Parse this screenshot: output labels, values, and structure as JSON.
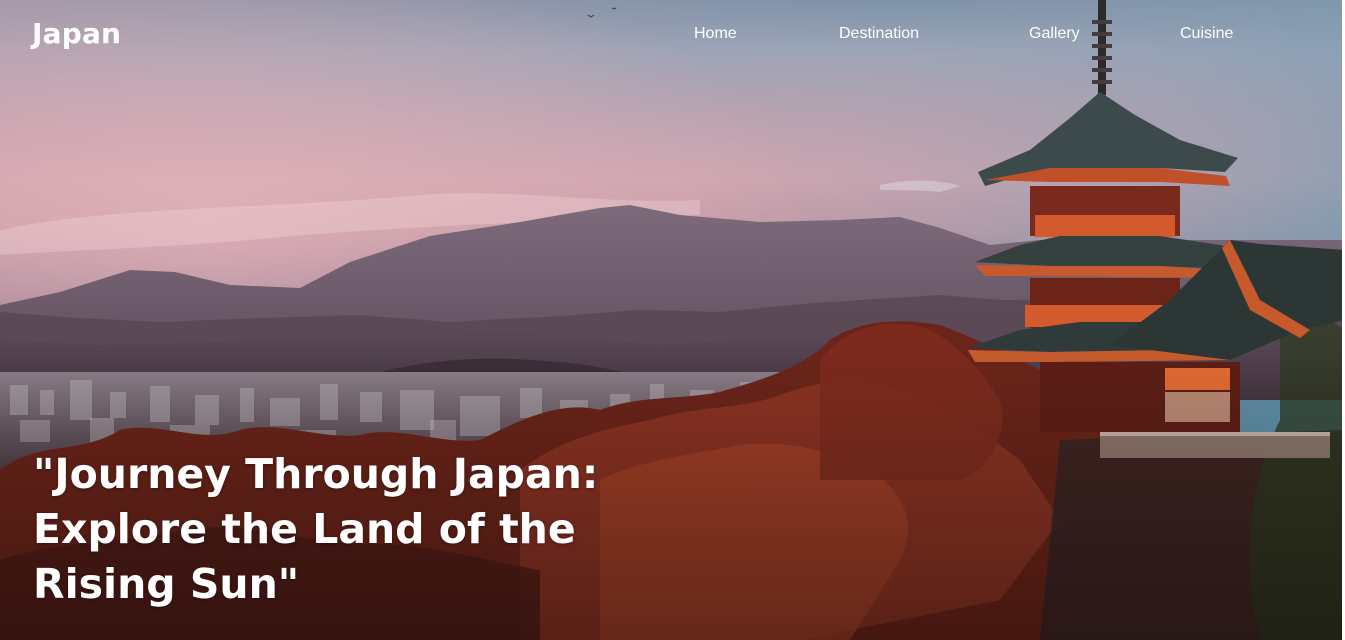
{
  "header": {
    "logo": "Japan",
    "nav": [
      {
        "label": "Home"
      },
      {
        "label": "Destination"
      },
      {
        "label": "Gallery"
      },
      {
        "label": "Cuisine"
      }
    ]
  },
  "hero": {
    "headline": "\"Journey Through Japan:\nExplore the Land of the\nRising Sun\""
  },
  "colors": {
    "text": "#ffffff",
    "sky_top": "#6f8fa6",
    "sky_pink": "#d5a6ae",
    "foliage": "#8a2f22",
    "pagoda_roof": "#3c4a4c",
    "pagoda_wood": "#c0502a"
  }
}
